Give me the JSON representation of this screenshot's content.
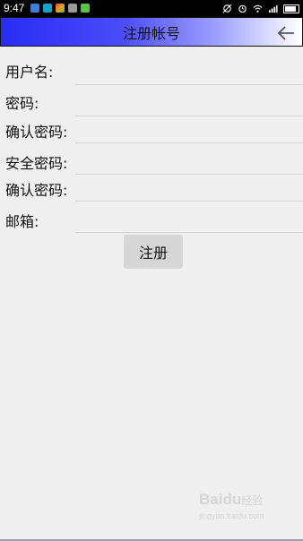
{
  "status_bar": {
    "time": "9:47",
    "app_icons": [
      {
        "name": "notification-icon-blue",
        "color": "#3b7fd8"
      },
      {
        "name": "notification-icon-teal",
        "color": "#1aa3c8"
      },
      {
        "name": "notification-icon-multicolor",
        "color": "#e8a020"
      },
      {
        "name": "notification-icon-gray",
        "color": "#9a9a9a"
      },
      {
        "name": "notification-icon-green",
        "color": "#5cc24a"
      }
    ],
    "right_icons": [
      "sync-off-icon",
      "alarm-icon",
      "wifi-icon",
      "signal-icon",
      "battery-icon"
    ]
  },
  "title_bar": {
    "title": "注册帐号",
    "back_icon": "arrow-left-icon",
    "gradient_start": "#2a2cf3",
    "gradient_end": "#ffffff"
  },
  "form": {
    "fields": [
      {
        "key": "username",
        "label": "用户名:",
        "value": ""
      },
      {
        "key": "password",
        "label": "密码:",
        "value": ""
      },
      {
        "key": "confirm_password",
        "label": "确认密码:",
        "value": ""
      },
      {
        "key": "security_password",
        "label": "安全密码:",
        "value": ""
      },
      {
        "key": "confirm_security_password",
        "label": "确认密码:",
        "value": ""
      },
      {
        "key": "email",
        "label": "邮箱:",
        "value": ""
      }
    ],
    "submit_label": "注册"
  },
  "watermark": {
    "brand": "Baidu",
    "suffix": "经验",
    "url": "jingyan.baidu.com"
  }
}
